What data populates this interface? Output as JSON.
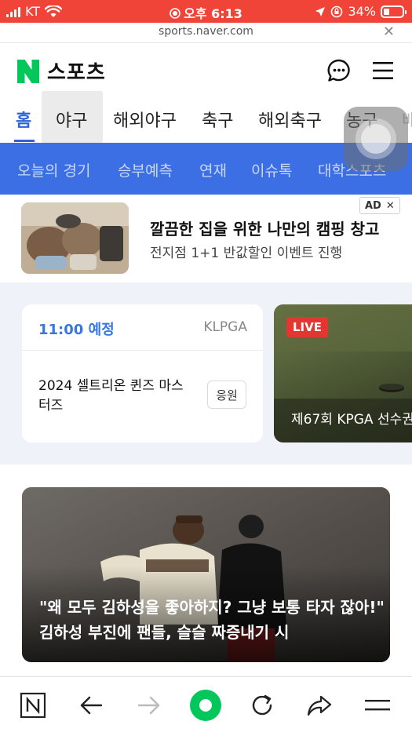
{
  "status_bar": {
    "carrier": "KT",
    "time": "오후 6:13",
    "battery": "34%",
    "battery_level": 0.34,
    "background": "#f04438"
  },
  "url_bar": {
    "url": "sports.naver.com",
    "close_icon": "close-icon"
  },
  "header": {
    "logo_letter": "N",
    "logo_text": "스포츠",
    "logo_color": "#03c75a",
    "icons": [
      "chat-bubble-icon",
      "hamburger-menu-icon"
    ]
  },
  "tabs": [
    {
      "label": "홈",
      "active": true
    },
    {
      "label": "야구",
      "active": false
    },
    {
      "label": "해외야구",
      "active": false
    },
    {
      "label": "축구",
      "active": false
    },
    {
      "label": "해외축구",
      "active": false
    },
    {
      "label": "농구",
      "active": false
    },
    {
      "label": "배",
      "active": false
    }
  ],
  "subnav": {
    "background": "#3b6fe3",
    "items": [
      "오늘의 경기",
      "승부예측",
      "연재",
      "이슈톡",
      "대학스포츠"
    ]
  },
  "ad": {
    "badge": "AD",
    "title": "깔끔한 집을 위한 나만의 캠핑 창고",
    "subtitle": "전지점 1+1 반값할인 이벤트 진행"
  },
  "schedule": {
    "game": {
      "time": "11:00 예정",
      "league": "KLPGA",
      "name": "2024 셀트리온 퀸즈 마스터즈",
      "cheer_label": "응원"
    },
    "live": {
      "badge": "LIVE",
      "title": "제67회 KPGA 선수권"
    }
  },
  "news": {
    "headline": "\"왜 모두 김하성을 좋아하지? 그냥 보통 타자 잖아!\" 김하성 부진에 팬들, 슬슬 짜증내기 시"
  },
  "toolbar": {
    "icons": [
      "naver-home-icon",
      "back-arrow-icon",
      "forward-arrow-icon",
      "green-dot-icon",
      "refresh-icon",
      "share-icon",
      "more-menu-icon"
    ],
    "accent": "#03c75a"
  }
}
